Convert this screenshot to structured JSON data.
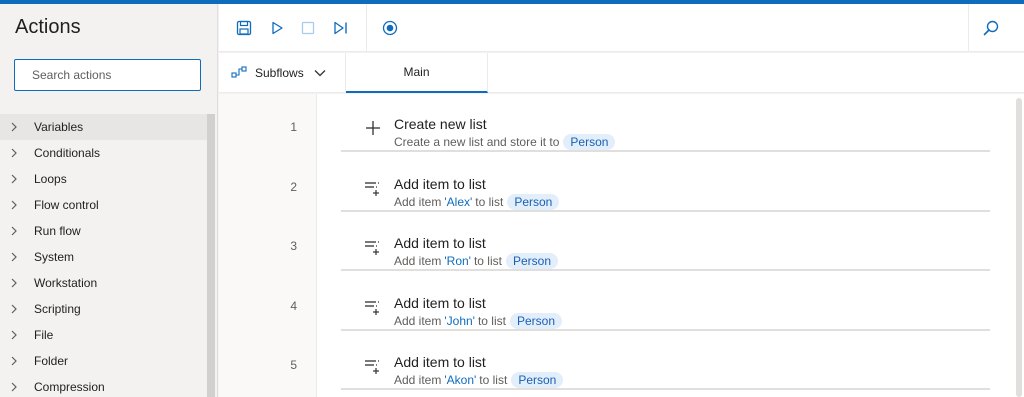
{
  "actions_pane": {
    "title": "Actions",
    "search_placeholder": "Search actions",
    "categories": [
      "Variables",
      "Conditionals",
      "Loops",
      "Flow control",
      "Run flow",
      "System",
      "Workstation",
      "Scripting",
      "File",
      "Folder",
      "Compression"
    ]
  },
  "toolbar": {
    "buttons": [
      "save-icon",
      "run-icon",
      "stop-icon",
      "run-next-action-icon",
      "record-icon",
      "search-icon"
    ]
  },
  "tabs": {
    "subflows_label": "Subflows",
    "main_label": "Main"
  },
  "flow": {
    "steps": [
      {
        "line": "1",
        "title": "Create new list",
        "prefix": "Create a new list and store it to",
        "item": "",
        "mid": "",
        "variable": "Person",
        "icon": "plus-icon"
      },
      {
        "line": "2",
        "title": "Add item to list",
        "prefix": "Add item",
        "item": "'Alex'",
        "mid": "to list",
        "variable": "Person",
        "icon": "add-item-icon"
      },
      {
        "line": "3",
        "title": "Add item to list",
        "prefix": "Add item",
        "item": "'Ron'",
        "mid": "to list",
        "variable": "Person",
        "icon": "add-item-icon"
      },
      {
        "line": "4",
        "title": "Add item to list",
        "prefix": "Add item",
        "item": "'John'",
        "mid": "to list",
        "variable": "Person",
        "icon": "add-item-icon"
      },
      {
        "line": "5",
        "title": "Add item to list",
        "prefix": "Add item",
        "item": "'Akon'",
        "mid": "to list",
        "variable": "Person",
        "icon": "add-item-icon"
      }
    ]
  },
  "colors": {
    "accent": "#0f6cbd",
    "pill_bg": "#e3eefb"
  }
}
